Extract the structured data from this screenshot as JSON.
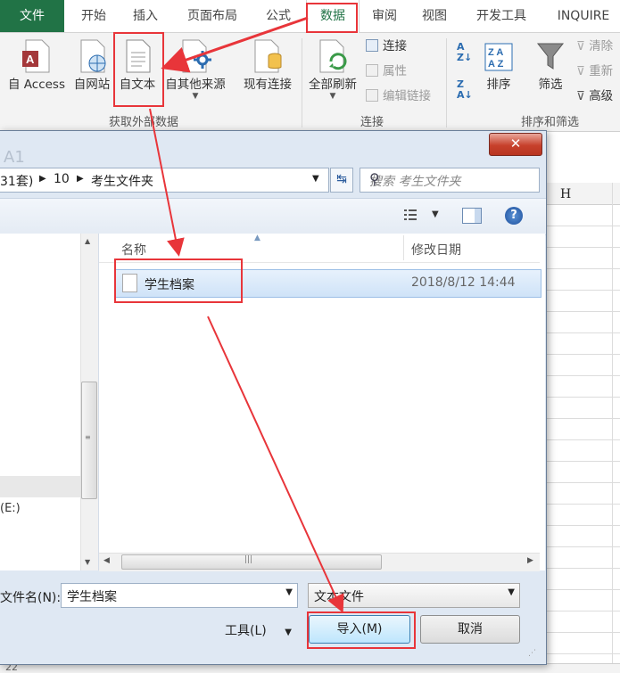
{
  "ribbon_tabs": {
    "file": "文件",
    "home": "开始",
    "insert": "插入",
    "layout": "页面布局",
    "formula": "公式",
    "data": "数据",
    "review": "审阅",
    "view": "视图",
    "developer": "开发工具",
    "inquire": "INQUIRE"
  },
  "ribbon": {
    "from_access": "自 Access",
    "from_web": "自网站",
    "from_text": "自文本",
    "from_other": "自其他来源",
    "existing": "现有连接",
    "refresh_all": "全部刷新",
    "connections": "连接",
    "properties": "属性",
    "edit_links": "编辑链接",
    "sort": "排序",
    "filter": "筛选",
    "clear": "清除",
    "reapply": "重新",
    "advanced": "高级",
    "group_external": "获取外部数据",
    "group_connections": "连接",
    "group_sort_filter": "排序和筛选"
  },
  "sheet": {
    "cell_ref": "A1",
    "col_h": "H",
    "row_22": "22"
  },
  "dialog": {
    "close": "✕",
    "path_partial": "31套)",
    "path_folder": "10",
    "path_current": "考生文件夹",
    "search_placeholder": "搜索 考生文件夹",
    "col_name": "名称",
    "col_date": "修改日期",
    "file_name": "学生档案",
    "file_date": "2018/8/12 14:44",
    "drive_label": "(E:)",
    "filename_label": "文件名(N):",
    "filename_value": "学生档案",
    "filetype_value": "文本文件",
    "tools": "工具(L)",
    "import": "导入(M)",
    "cancel": "取消"
  },
  "colors": {
    "excel_green": "#217346",
    "annotation_red": "#e8353a"
  }
}
